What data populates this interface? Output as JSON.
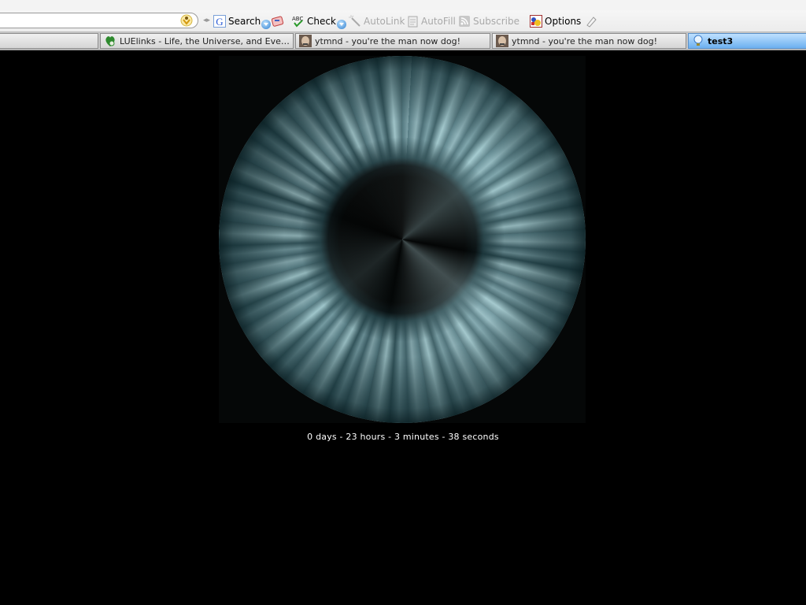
{
  "toolbar": {
    "search_value": "",
    "items": [
      {
        "label": "Search",
        "icon": "google-g-icon",
        "enabled": true
      },
      {
        "label": "Check",
        "icon": "spellcheck-abc-icon",
        "enabled": true
      },
      {
        "label": "AutoLink",
        "icon": "magic-wand-icon",
        "enabled": false
      },
      {
        "label": "AutoFill",
        "icon": "form-autofill-icon",
        "enabled": false
      },
      {
        "label": "Subscribe",
        "icon": "rss-feed-icon",
        "enabled": false
      },
      {
        "label": "Options",
        "icon": "options-shapes-icon",
        "enabled": true
      }
    ]
  },
  "tabs": [
    {
      "title": "",
      "favicon": "none",
      "active": false
    },
    {
      "title": "LUElinks - Life, the Universe, and Everyt...",
      "favicon": "luelinks-icon",
      "active": false
    },
    {
      "title": "ytmnd - you're the man now dog!",
      "favicon": "ytmnd-face-icon",
      "active": false
    },
    {
      "title": "ytmnd - you're the man now dog!",
      "favicon": "ytmnd-face-icon",
      "active": false
    },
    {
      "title": "test3",
      "favicon": "lightbulb-icon",
      "active": true
    }
  ],
  "page": {
    "image": "eye-iris-image",
    "countdown": "0 days - 23 hours - 3 minutes - 38 seconds"
  }
}
